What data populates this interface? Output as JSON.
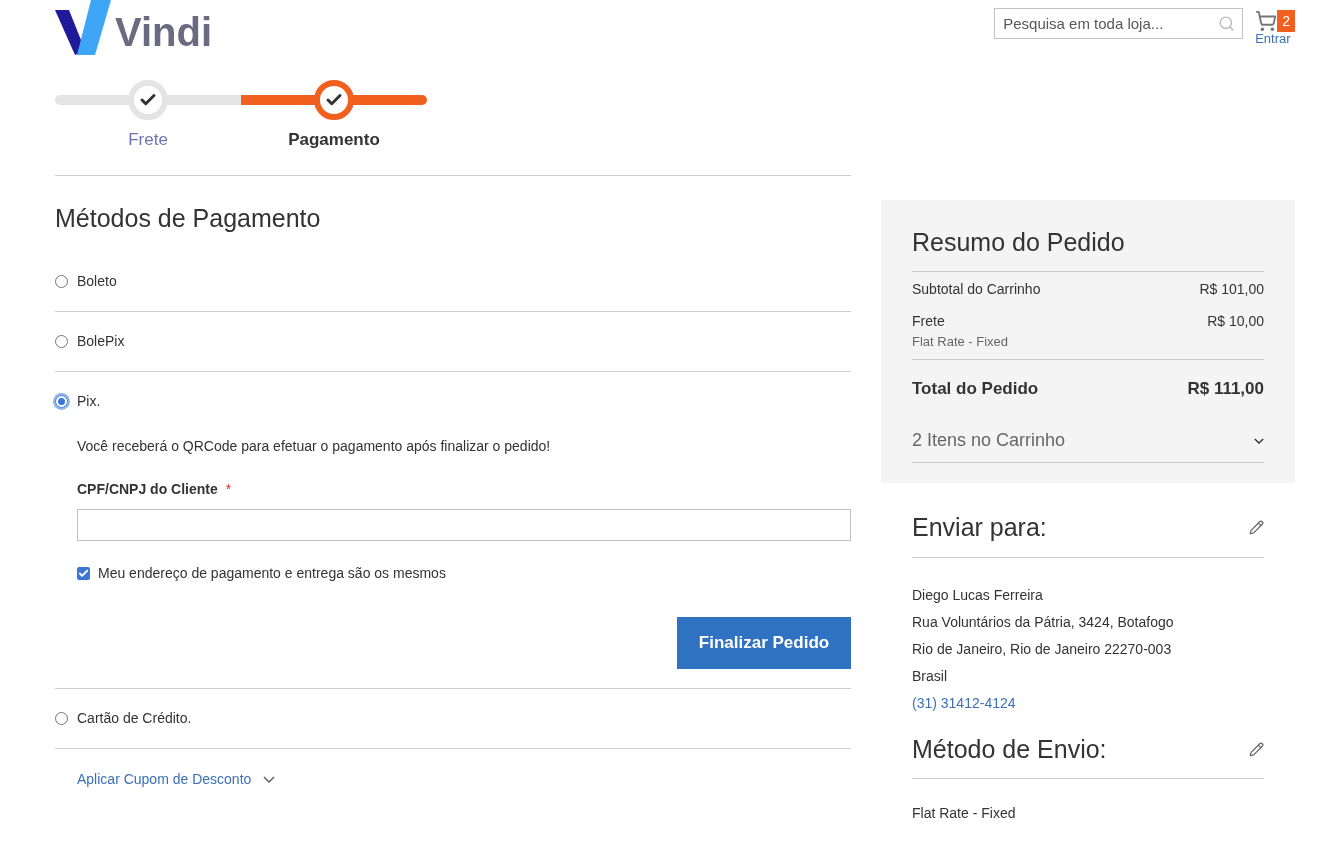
{
  "header": {
    "logo": "Vindi",
    "search": {
      "placeholder": "Pesquisa em toda loja..."
    },
    "cart_count": "2",
    "login": "Entrar"
  },
  "steps": [
    {
      "label": "Frete",
      "selected": false
    },
    {
      "label": "Pagamento",
      "selected": true
    }
  ],
  "payment": {
    "title": "Métodos de Pagamento",
    "methods": [
      {
        "label": "Boleto",
        "selected": false
      },
      {
        "label": "BolePix",
        "selected": false
      },
      {
        "label": "Pix.",
        "selected": true,
        "message": "Você receberá o QRCode para efetuar o pagamento após finalizar o pedido!",
        "field_label": "CPF/CNPJ do Cliente",
        "required_mark": "*",
        "same_address": {
          "label": "Meu endereço de pagamento e entrega são os mesmos",
          "checked": true
        },
        "button": "Finalizar Pedido"
      },
      {
        "label": "Cartão de Crédito.",
        "selected": false
      }
    ],
    "coupon": {
      "label": "Aplicar Cupom de Desconto",
      "expanded": false
    }
  },
  "summary": {
    "title": "Resumo do Pedido",
    "rows": [
      {
        "label": "Subtotal do Carrinho",
        "value": "R$ 101,00"
      },
      {
        "label": "Frete",
        "value": "R$ 10,00",
        "detail": "Flat Rate - Fixed"
      }
    ],
    "total": {
      "label": "Total do Pedido",
      "value": "R$ 111,00"
    },
    "items": {
      "label": "2 Itens no Carrinho",
      "expanded": false
    }
  },
  "ship_to": {
    "title": "Enviar para:",
    "lines": [
      "Diego Lucas Ferreira",
      "Rua Voluntários da Pátria, 3424, Botafogo",
      "Rio de Janeiro, Rio de Janeiro 22270-003",
      "Brasil"
    ],
    "phone": "(31) 31412-4124"
  },
  "ship_method": {
    "title": "Método de Envio:",
    "value": "Flat Rate - Fixed"
  }
}
